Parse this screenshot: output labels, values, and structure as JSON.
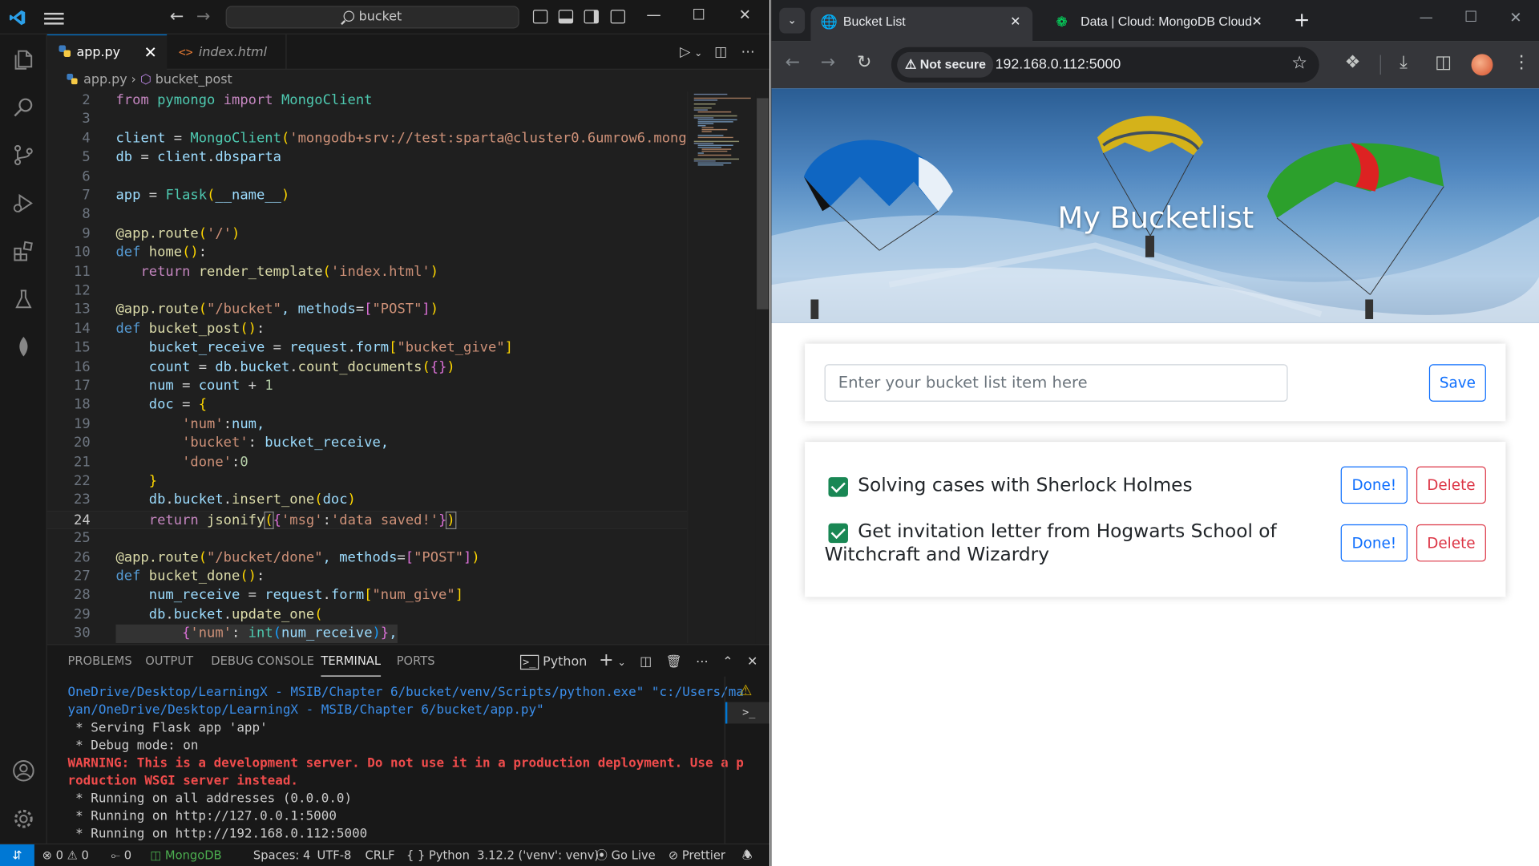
{
  "vscode": {
    "search_text": "bucket",
    "tabs": [
      {
        "label": "app.py"
      },
      {
        "label": "index.html"
      }
    ],
    "breadcrumb": {
      "file": "app.py",
      "symbol": "bucket_post"
    },
    "line_numbers": [
      "2",
      "3",
      "4",
      "5",
      "6",
      "7",
      "8",
      "9",
      "10",
      "11",
      "12",
      "13",
      "14",
      "15",
      "16",
      "17",
      "18",
      "19",
      "20",
      "21",
      "22",
      "23",
      "24",
      "25",
      "26",
      "27",
      "28",
      "29",
      "30"
    ],
    "panel_tabs": [
      "PROBLEMS",
      "OUTPUT",
      "DEBUG CONSOLE",
      "TERMINAL",
      "PORTS"
    ],
    "terminal_profile": "Python",
    "terminal_lines": [
      "OneDrive/Desktop/LearningX - MSIB/Chapter 6/bucket/venv/Scripts/python.exe\" \"c:/Users/ma",
      "yan/OneDrive/Desktop/LearningX - MSIB/Chapter 6/bucket/app.py\"",
      " * Serving Flask app 'app'",
      " * Debug mode: on",
      "WARNING: This is a development server. Do not use it in a production deployment. Use a p",
      "roduction WSGI server instead.",
      " * Running on all addresses (0.0.0.0)",
      " * Running on http://127.0.0.1:5000",
      " * Running on http://192.168.0.112:5000"
    ],
    "status": {
      "errors": "0",
      "warnings": "0",
      "ports": "0",
      "mongodb": "MongoDB",
      "spaces": "Spaces: 4",
      "encoding": "UTF-8",
      "eol": "CRLF",
      "language": "Python",
      "interpreter": "3.12.2 ('venv': venv)",
      "golive": "Go Live",
      "prettier": "Prettier"
    }
  },
  "browser": {
    "tabs": [
      {
        "label": "Bucket List"
      },
      {
        "label": "Data | Cloud: MongoDB Cloud"
      }
    ],
    "not_secure": "Not secure",
    "url": "192.168.0.112:5000",
    "page": {
      "title": "My Bucketlist",
      "input_placeholder": "Enter your bucket list item here",
      "save_label": "Save",
      "items": [
        {
          "text": "Solving cases with Sherlock Holmes",
          "done_label": "Done!",
          "delete_label": "Delete",
          "checked": true
        },
        {
          "text": "Get invitation letter from Hogwarts School of Witchcraft and Wizardry",
          "done_label": "Done!",
          "delete_label": "Delete",
          "checked": true
        }
      ]
    }
  },
  "colors": {
    "vscode_accent": "#0078d4",
    "bootstrap_primary": "#0d6efd",
    "bootstrap_danger": "#dc3545",
    "checkbox_green": "#198754"
  }
}
